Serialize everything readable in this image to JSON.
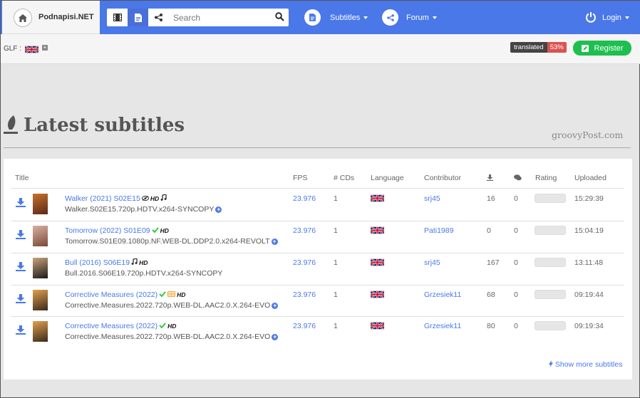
{
  "brand": {
    "name": "Podnapisi.NET"
  },
  "search": {
    "placeholder": "Search"
  },
  "nav": {
    "subtitles": "Subtitles",
    "forum": "Forum",
    "login": "Login"
  },
  "subbar": {
    "glf": "GLF :",
    "translated_label": "translated",
    "translated_pct": "53%",
    "register": "Register"
  },
  "heading": "Latest subtitles",
  "watermark": "groovyPost.com",
  "columns": {
    "title": "Title",
    "fps": "FPS",
    "cds": "# CDs",
    "language": "Language",
    "contributor": "Contributor",
    "rating": "Rating",
    "uploaded": "Uploaded"
  },
  "rows": [
    {
      "title": "Walker (2021) S02E15",
      "release": "Walker.S02E15.720p.HDTV.x264-SYNCOPY",
      "fps": "23.976",
      "cds": "1",
      "contributor": "srj45",
      "downloads": "16",
      "comments": "0",
      "uploaded": "15:29:39",
      "poster_colors": [
        "#5a2a1a",
        "#c8702a"
      ]
    },
    {
      "title": "Tomorrow (2022) S01E09",
      "release": "Tomorrow.S01E09.1080p.NF.WEB-DL.DDP2.0.x264-REVOLT",
      "fps": "23.976",
      "cds": "1",
      "contributor": "Pati1989",
      "downloads": "0",
      "comments": "0",
      "uploaded": "15:04:19",
      "poster_colors": [
        "#7a4a3a",
        "#d8b0a0"
      ]
    },
    {
      "title": "Bull (2016) S06E19",
      "release": "Bull.2016.S06E19.720p.HDTV.x264-SYNCOPY",
      "fps": "23.976",
      "cds": "1",
      "contributor": "srj45",
      "downloads": "167",
      "comments": "0",
      "uploaded": "13:11:48",
      "poster_colors": [
        "#1a1a1a",
        "#c9a27a"
      ]
    },
    {
      "title": "Corrective Measures (2022)",
      "release": "Corrective.Measures.2022.720p.WEB-DL.AAC2.0.X.264-EVO",
      "fps": "23.976",
      "cds": "1",
      "contributor": "Grzesiek11",
      "downloads": "68",
      "comments": "0",
      "uploaded": "09:19:44",
      "poster_colors": [
        "#3a2a1a",
        "#e0a050"
      ]
    },
    {
      "title": "Corrective Measures (2022)",
      "release": "Corrective.Measures.2022.720p.WEB-DL.AAC2.0.X.264-EVO",
      "fps": "23.976",
      "cds": "1",
      "contributor": "Grzesiek11",
      "downloads": "80",
      "comments": "0",
      "uploaded": "09:19:34",
      "poster_colors": [
        "#3a2a1a",
        "#e0a050"
      ]
    }
  ],
  "show_more": "Show more subtitles",
  "colors": {
    "navbar": "#4a78e8",
    "link": "#4a78e8",
    "register": "#1dbf4f",
    "check": "#2ecc40",
    "cc": "#f0a020"
  }
}
